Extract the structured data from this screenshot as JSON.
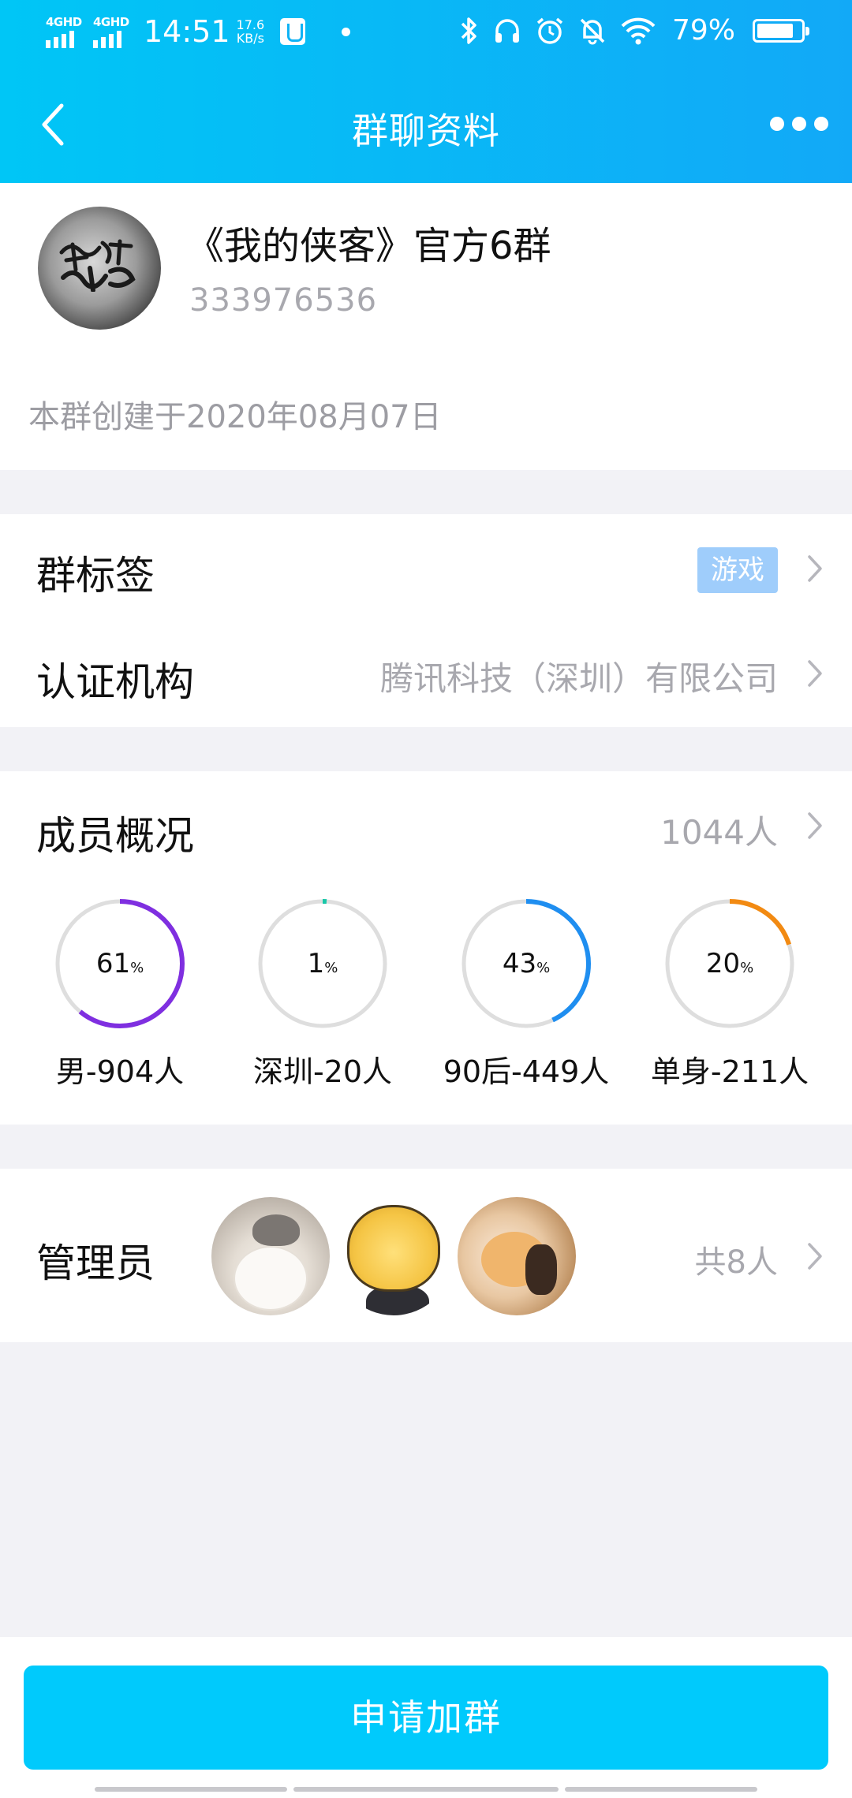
{
  "status_bar": {
    "signal1": "4GHD",
    "signal2": "4GHD",
    "time": "14:51",
    "speed_value": "17.6",
    "speed_unit": "KB/s",
    "battery_percent": "79%",
    "icons": [
      "bluetooth-icon",
      "headphones-icon",
      "alarm-icon",
      "mute-icon",
      "wifi-icon",
      "battery-icon"
    ]
  },
  "nav": {
    "title": "群聊资料",
    "back_icon": "back-chevron-icon",
    "more_icon": "more-dots-icon"
  },
  "group": {
    "name": "《我的侠客》官方6群",
    "id": "333976536",
    "created": "本群创建于2020年08月07日"
  },
  "tags_row": {
    "label": "群标签",
    "tag": "游戏"
  },
  "cert_row": {
    "label": "认证机构",
    "value": "腾讯科技（深圳）有限公司"
  },
  "members": {
    "label": "成员概况",
    "count": "1044人",
    "stats": [
      {
        "percent": 61,
        "percent_text": "61",
        "unit": "%",
        "caption": "男-904人",
        "color": "#7f2fe0"
      },
      {
        "percent": 1,
        "percent_text": "1",
        "unit": "%",
        "caption": "深圳-20人",
        "color": "#18c7a8"
      },
      {
        "percent": 43,
        "percent_text": "43",
        "unit": "%",
        "caption": "90后-449人",
        "color": "#1f8ef0"
      },
      {
        "percent": 20,
        "percent_text": "20",
        "unit": "%",
        "caption": "单身-211人",
        "color": "#f28a12"
      }
    ]
  },
  "admins": {
    "label": "管理员",
    "count": "共8人"
  },
  "join_button": "申请加群",
  "colors": {
    "header_start": "#00c6f6",
    "header_end": "#12a9f7",
    "button": "#00cafc",
    "tag_bg": "#9fcdfb",
    "ring_track": "#dedede"
  }
}
